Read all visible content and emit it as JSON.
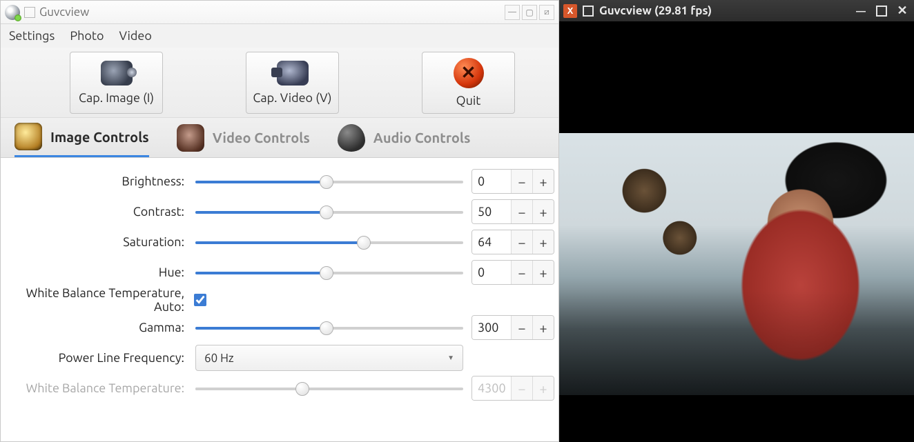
{
  "left_window": {
    "title": "Guvcview",
    "menu": {
      "settings": "Settings",
      "photo": "Photo",
      "video": "Video"
    },
    "toolbar": {
      "cap_image": "Cap. Image (I)",
      "cap_video": "Cap. Video (V)",
      "quit": "Quit"
    },
    "tabs": {
      "image": "Image Controls",
      "video": "Video Controls",
      "audio": "Audio Controls",
      "active": "image"
    },
    "controls": {
      "brightness": {
        "label": "Brightness:",
        "value": 0,
        "pct": 49
      },
      "contrast": {
        "label": "Contrast:",
        "value": 50,
        "pct": 49
      },
      "saturation": {
        "label": "Saturation:",
        "value": 64,
        "pct": 63
      },
      "hue": {
        "label": "Hue:",
        "value": 0,
        "pct": 49
      },
      "wb_auto": {
        "label": "White Balance Temperature, Auto:",
        "checked": true
      },
      "gamma": {
        "label": "Gamma:",
        "value": 300,
        "pct": 49
      },
      "plf": {
        "label": "Power Line Frequency:",
        "value": "60 Hz"
      },
      "wb_temp": {
        "label": "White Balance Temperature:",
        "value": 4300,
        "pct": 40,
        "disabled": true
      }
    }
  },
  "right_window": {
    "title": "Guvcview (29.81 fps)"
  }
}
